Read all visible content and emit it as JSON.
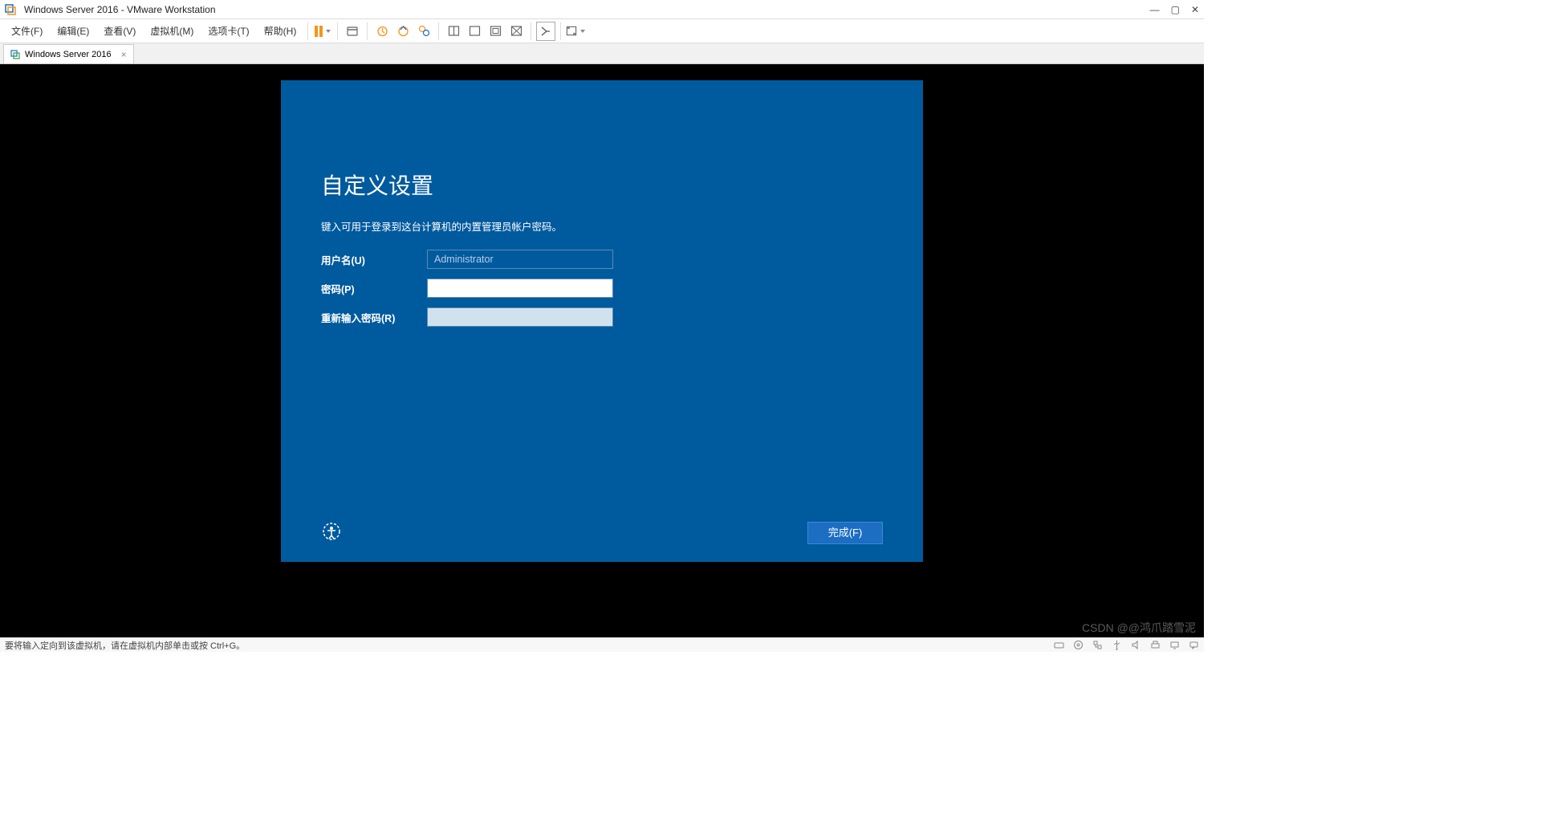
{
  "titlebar": {
    "title": "Windows Server 2016 - VMware Workstation"
  },
  "menubar": {
    "items": [
      "文件(F)",
      "编辑(E)",
      "查看(V)",
      "虚拟机(M)",
      "选项卡(T)",
      "帮助(H)"
    ]
  },
  "tab": {
    "label": "Windows Server 2016"
  },
  "guest": {
    "title": "自定义设置",
    "desc": "键入可用于登录到这台计算机的内置管理员帐户密码。",
    "username_label": "用户名(U)",
    "username_value": "Administrator",
    "password_label": "密码(P)",
    "password_value": "",
    "reenter_label": "重新输入密码(R)",
    "reenter_value": "",
    "finish_label": "完成(F)"
  },
  "statusbar": {
    "hint": "要将输入定向到该虚拟机，请在虚拟机内部单击或按 Ctrl+G。"
  },
  "watermark": "CSDN @@鸿爪踏雪泥"
}
